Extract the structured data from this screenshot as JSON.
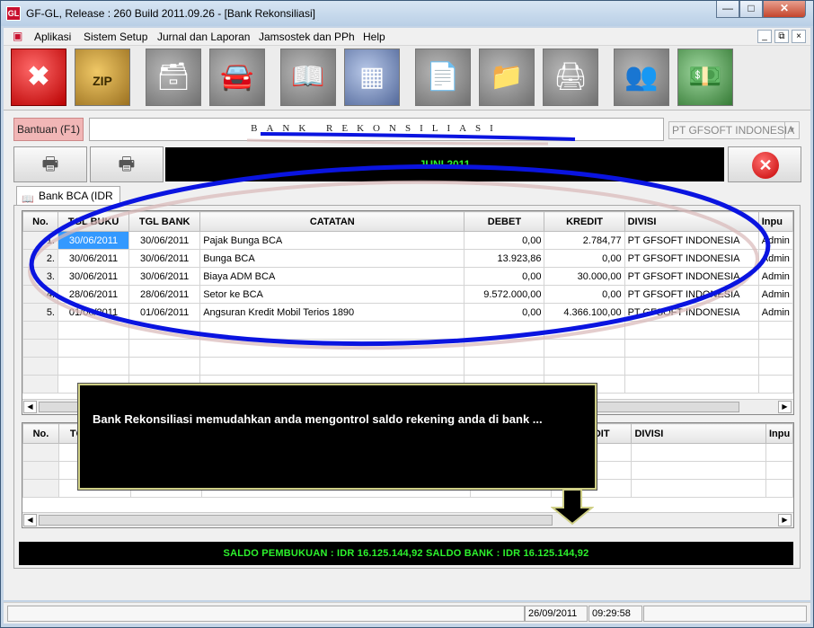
{
  "window": {
    "title": "GF-GL, Release : 260 Build 2011.09.26 - [Bank Rekonsiliasi]",
    "app_icon_text": "GL"
  },
  "menu": [
    {
      "label": "Aplikasi"
    },
    {
      "label": "Sistem Setup"
    },
    {
      "label": "Jurnal dan Laporan"
    },
    {
      "label": "Jamsostek dan PPh"
    },
    {
      "label": "Help"
    }
  ],
  "toolbar": [
    {
      "name": "exit-icon"
    },
    {
      "name": "zip-box-icon"
    },
    {
      "name": "card-index-icon"
    },
    {
      "name": "car-icon"
    },
    {
      "name": "ledger-book-icon"
    },
    {
      "name": "spreadsheet-icon"
    },
    {
      "name": "stamped-document-icon"
    },
    {
      "name": "report-folders-icon"
    },
    {
      "name": "printer-icon"
    },
    {
      "name": "users-icon"
    },
    {
      "name": "money-stack-icon"
    }
  ],
  "form": {
    "help_label": "Bantuan (F1)",
    "form_title": "BANK REKONSILIASI",
    "company_select": "PT GFSOFT INDONESIA",
    "period": "JUNI 2011",
    "tab_label": "Bank BCA (IDR )"
  },
  "upper_grid": {
    "columns": [
      "No.",
      "TGL BUKU",
      "TGL BANK",
      "CATATAN",
      "DEBET",
      "KREDIT",
      "DIVISI",
      "Inpu"
    ],
    "rows": [
      {
        "no": "1.",
        "tgl_buku": "30/06/2011",
        "tgl_bank": "30/06/2011",
        "catatan": "Pajak Bunga BCA",
        "debet": "0,00",
        "kredit": "2.784,77",
        "divisi": "PT GFSOFT INDONESIA",
        "input": "Admin"
      },
      {
        "no": "2.",
        "tgl_buku": "30/06/2011",
        "tgl_bank": "30/06/2011",
        "catatan": "Bunga BCA",
        "debet": "13.923,86",
        "kredit": "0,00",
        "divisi": "PT GFSOFT INDONESIA",
        "input": "Admin"
      },
      {
        "no": "3.",
        "tgl_buku": "30/06/2011",
        "tgl_bank": "30/06/2011",
        "catatan": "Biaya ADM BCA",
        "debet": "0,00",
        "kredit": "30.000,00",
        "divisi": "PT GFSOFT INDONESIA",
        "input": "Admin"
      },
      {
        "no": "4.",
        "tgl_buku": "28/06/2011",
        "tgl_bank": "28/06/2011",
        "catatan": "Setor ke BCA",
        "debet": "9.572.000,00",
        "kredit": "0,00",
        "divisi": "PT GFSOFT INDONESIA",
        "input": "Admin"
      },
      {
        "no": "5.",
        "tgl_buku": "01/06/2011",
        "tgl_bank": "01/06/2011",
        "catatan": "Angsuran Kredit Mobil Terios 1890",
        "debet": "0,00",
        "kredit": "4.366.100,00",
        "divisi": "PT GFSOFT INDONESIA",
        "input": "Admin"
      }
    ]
  },
  "lower_grid": {
    "columns": [
      "No.",
      "TG",
      "",
      "",
      "",
      "KREDIT",
      "DIVISI",
      "Inpu"
    ]
  },
  "saldo_text": "SALDO PEMBUKUAN : IDR  16.125.144,92     SALDO BANK : IDR  16.125.144,92",
  "callout_text": "Bank Rekonsiliasi memudahkan anda mengontrol saldo rekening anda di bank ...",
  "status": {
    "date": "26/09/2011",
    "time": "09:29:58"
  },
  "colors": {
    "accent_green": "#2df22d",
    "annotation_blue": "#0a14e0",
    "selection": "#3399ff"
  }
}
